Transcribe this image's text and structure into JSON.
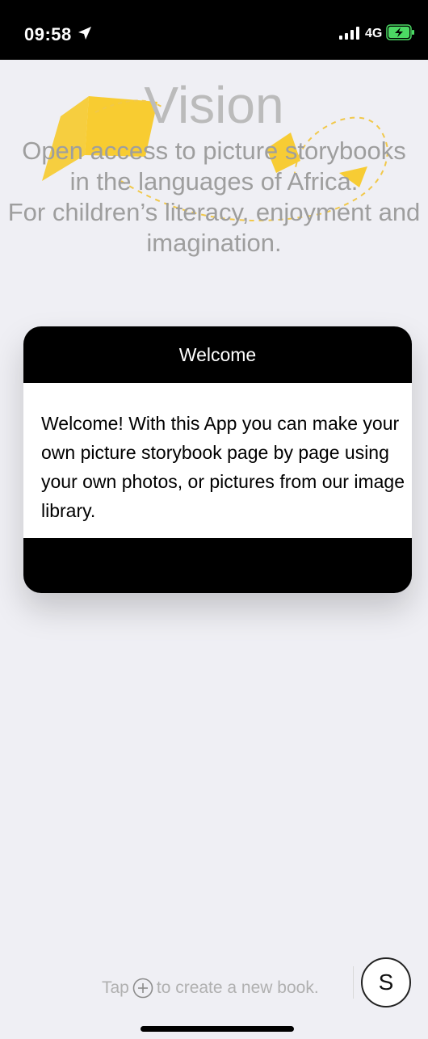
{
  "status_bar": {
    "time": "09:58",
    "location_icon": "location-arrow-icon",
    "signal_icon": "cellular-signal-icon",
    "network": "4G",
    "battery_icon": "battery-charging-icon"
  },
  "vision": {
    "title": "Vision",
    "lines": [
      "Open access to picture storybooks",
      "in the languages of Africa.",
      "For children’s literacy, enjoyment and",
      "imagination."
    ]
  },
  "dialog": {
    "title": "Welcome",
    "message": "Welcome! With this App you can make your own picture storybook page by page using your own photos, or pictures from our image library."
  },
  "bottom": {
    "hint_before": "Tap",
    "plus_icon": "plus-circle-icon",
    "hint_after": "to create a new book.",
    "profile_initial": "S"
  },
  "colors": {
    "status_bar": "#000000",
    "background": "#efeff4",
    "accent_yellow": "#f7c81f",
    "dialog_header": "#000000",
    "dialog_body": "#ffffff"
  }
}
